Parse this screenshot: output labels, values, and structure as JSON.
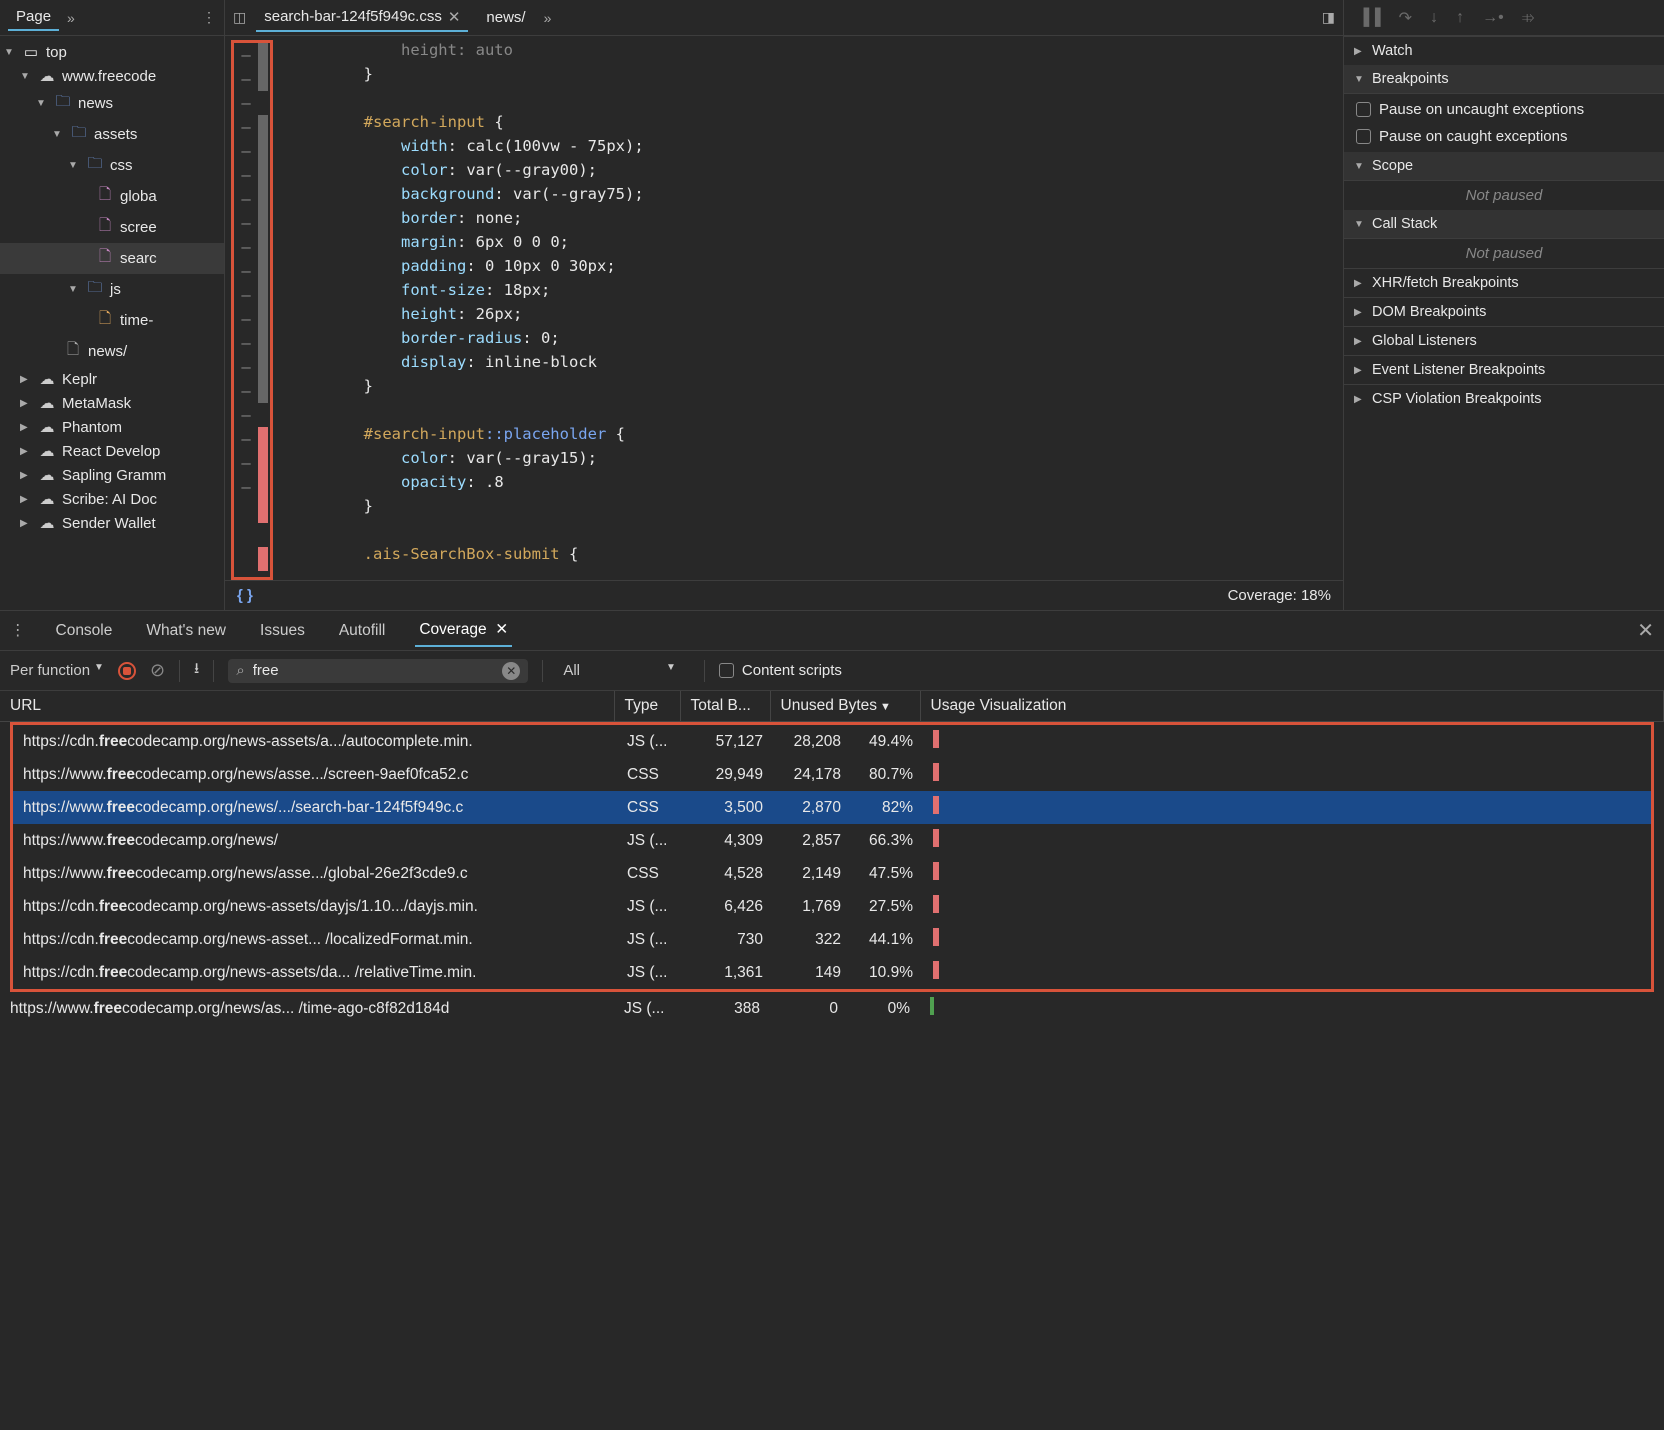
{
  "file_tree_header": {
    "tab": "Page"
  },
  "tree": {
    "top": "top",
    "domain": "www.freecode",
    "news": "news",
    "assets": "assets",
    "css": "css",
    "globa": "globa",
    "scree": "scree",
    "searc": "searc",
    "js": "js",
    "time": "time-",
    "news2": "news/",
    "ext1": "Keplr",
    "ext2": "MetaMask",
    "ext3": "Phantom",
    "ext4": "React Develop",
    "ext5": "Sapling Gramm",
    "ext6": "Scribe: AI Doc",
    "ext7": "Sender Wallet"
  },
  "editor": {
    "active_tab": "search-bar-124f5f949c.css",
    "secondary_tab": "news/",
    "code": {
      "l1": "        }",
      "l2": "",
      "l3": "        #search-input {",
      "l4": "            width: calc(100vw - 75px);",
      "l5": "            color: var(--gray00);",
      "l6": "            background: var(--gray75);",
      "l7": "            border: none;",
      "l8": "            margin: 6px 0 0 0;",
      "l9": "            padding: 0 10px 0 30px;",
      "l10": "            font-size: 18px;",
      "l11": "            height: 26px;",
      "l12": "            border-radius: 0;",
      "l13": "            display: inline-block",
      "l14": "        }",
      "l15": "",
      "l16": "        #search-input::placeholder {",
      "l17": "            color: var(--gray15);",
      "l18": "            opacity: .8",
      "l19": "        }",
      "l20": "",
      "l21": "        .ais-SearchBox-submit {"
    },
    "footer": "Coverage: 18%"
  },
  "debugger": {
    "watch": "Watch",
    "breakpoints": "Breakpoints",
    "uncaught": "Pause on uncaught exceptions",
    "caught": "Pause on caught exceptions",
    "scope": "Scope",
    "not_paused": "Not paused",
    "callstack": "Call Stack",
    "xhr": "XHR/fetch Breakpoints",
    "dom": "DOM Breakpoints",
    "global": "Global Listeners",
    "event": "Event Listener Breakpoints",
    "csp": "CSP Violation Breakpoints"
  },
  "drawer": {
    "console": "Console",
    "whats_new": "What's new",
    "issues": "Issues",
    "autofill": "Autofill",
    "coverage": "Coverage"
  },
  "coverage_toolbar": {
    "per_function": "Per function",
    "filter_value": "free",
    "type_filter": "All",
    "content_scripts": "Content scripts"
  },
  "coverage_headers": {
    "url": "URL",
    "type": "Type",
    "total": "Total B...",
    "unused": "Unused Bytes",
    "viz": "Usage Visualization"
  },
  "coverage_rows": [
    {
      "url_pre": "https://cdn.",
      "url_bold": "free",
      "url_post": "codecamp.org/news-assets/a.../autocomplete.min.",
      "type": "JS (...",
      "total": "57,127",
      "unused": "28,208",
      "pct": "49.4%"
    },
    {
      "url_pre": "https://www.",
      "url_bold": "free",
      "url_post": "codecamp.org/news/asse.../screen-9aef0fca52.c",
      "type": "CSS",
      "total": "29,949",
      "unused": "24,178",
      "pct": "80.7%"
    },
    {
      "url_pre": "https://www.",
      "url_bold": "free",
      "url_post": "codecamp.org/news/.../search-bar-124f5f949c.c",
      "type": "CSS",
      "total": "3,500",
      "unused": "2,870",
      "pct": "82%",
      "selected": true
    },
    {
      "url_pre": "https://www.",
      "url_bold": "free",
      "url_post": "codecamp.org/news/",
      "type": "JS (...",
      "total": "4,309",
      "unused": "2,857",
      "pct": "66.3%"
    },
    {
      "url_pre": "https://www.",
      "url_bold": "free",
      "url_post": "codecamp.org/news/asse.../global-26e2f3cde9.c",
      "type": "CSS",
      "total": "4,528",
      "unused": "2,149",
      "pct": "47.5%"
    },
    {
      "url_pre": "https://cdn.",
      "url_bold": "free",
      "url_post": "codecamp.org/news-assets/dayjs/1.10.../dayjs.min.",
      "type": "JS (...",
      "total": "6,426",
      "unused": "1,769",
      "pct": "27.5%"
    },
    {
      "url_pre": "https://cdn.",
      "url_bold": "free",
      "url_post": "codecamp.org/news-asset... /localizedFormat.min.",
      "type": "JS (...",
      "total": "730",
      "unused": "322",
      "pct": "44.1%"
    },
    {
      "url_pre": "https://cdn.",
      "url_bold": "free",
      "url_post": "codecamp.org/news-assets/da... /relativeTime.min.",
      "type": "JS (...",
      "total": "1,361",
      "unused": "149",
      "pct": "10.9%"
    }
  ],
  "coverage_outer_row": {
    "url_pre": "https://www.",
    "url_bold": "free",
    "url_post": "codecamp.org/news/as... /time-ago-c8f82d184d",
    "type": "JS (...",
    "total": "388",
    "unused": "0",
    "pct": "0%"
  }
}
